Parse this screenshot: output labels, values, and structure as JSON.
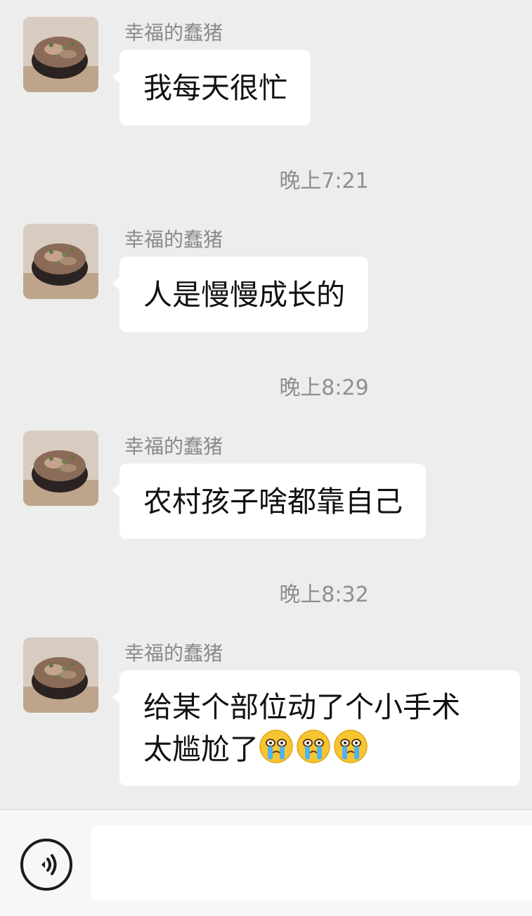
{
  "contact": {
    "name": "幸福的蠢猪",
    "avatar_icon": "food-photo-avatar-icon"
  },
  "messages": [
    {
      "sender": "幸福的蠢猪",
      "text": "我每天很忙"
    },
    {
      "time": "晚上7:21"
    },
    {
      "sender": "幸福的蠢猪",
      "text": "人是慢慢成长的"
    },
    {
      "time": "晚上8:29"
    },
    {
      "sender": "幸福的蠢猪",
      "text": "农村孩子啥都靠自己"
    },
    {
      "time": "晚上8:32"
    },
    {
      "sender": "幸福的蠢猪",
      "lines": [
        "给某个部位动了个小手术",
        "太尴尬了"
      ],
      "emojis": [
        "crying-face-emoji",
        "crying-face-emoji",
        "crying-face-emoji"
      ]
    }
  ],
  "input_bar": {
    "voice_icon": "voice-mode-icon",
    "placeholder": ""
  },
  "colors": {
    "background": "#ededed",
    "bubble": "#ffffff",
    "sender": "#8a8a8a",
    "time": "#8f8f8f"
  }
}
